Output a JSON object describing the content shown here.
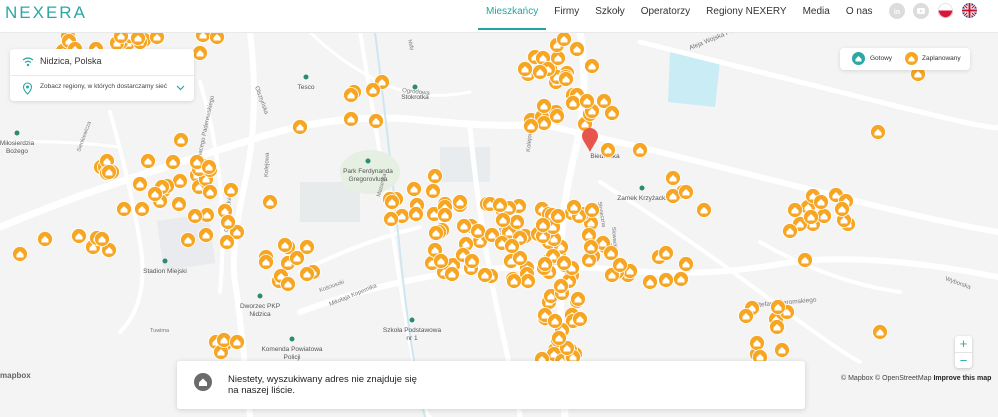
{
  "header": {
    "logo": "NEXERA",
    "nav": [
      "Mieszkańcy",
      "Firmy",
      "Szkoły",
      "Operatorzy",
      "Regiony NEXERY",
      "Media",
      "O nas"
    ],
    "active_nav": "Mieszkańcy",
    "social_icons": [
      "linkedin-icon",
      "youtube-icon"
    ],
    "languages": [
      "pl-flag-icon",
      "uk-flag-icon"
    ]
  },
  "search": {
    "location": "Nidzica, Polska"
  },
  "regions_link": "Zobacz regiony, w których dostarczamy sieć",
  "legend": [
    {
      "label": "Gotowy",
      "color": "#2aa8a4"
    },
    {
      "label": "Zaplanowany",
      "color": "#f6a623"
    }
  ],
  "colors": {
    "accent": "#2aa8a4",
    "planned": "#f6a623",
    "pin": "#e8554e"
  },
  "map_labels": {
    "streets": [
      "Aleja Wojska Polskiego",
      "Ogrodowa",
      "Grunwaldzka",
      "Olsztyńska",
      "Kolejowa",
      "Wyborska",
      "Mikołaja Kopernika",
      "Ignacego Paderewskiego",
      "Stefana Żeromskiego",
      "Kasprowicza",
      "Kolejowa",
      "Nidy",
      "Mazurska",
      "Słoneczna",
      "Jagiełły",
      "Kościuszki",
      "Sienkiewicza",
      "Tuwima",
      "Słowackiego",
      "Mickiewicza"
    ],
    "places": [
      "Miłosierdzia Bożego",
      "Tesco",
      "Stokrotka",
      "Park Ferdynanda Gregorovlusa",
      "Biedronka",
      "Zamek Krzyżacki",
      "Stadion Miejski",
      "Dworzec PKP Nidzica",
      "Szkoła Podstawowa nr 1",
      "Komenda Powiatowa Policji"
    ]
  },
  "zoom": {
    "in": "+",
    "out": "−"
  },
  "notice": "Niestety, wyszukiwany adres nie znajduje się na naszej liście.",
  "attribution": {
    "mapbox": "© Mapbox",
    "osm": "© OpenStreetMap",
    "improve": "Improve this map"
  },
  "mapbox_logo": "mapbox"
}
